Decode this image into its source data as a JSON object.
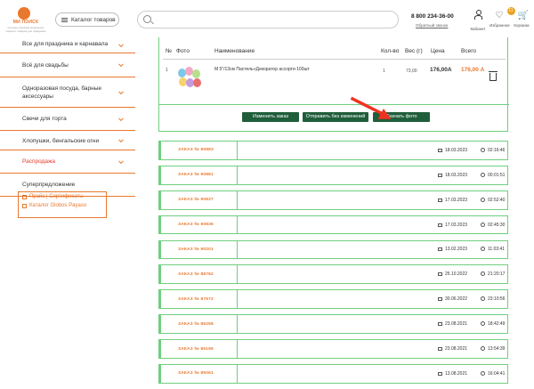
{
  "header": {
    "brand": "МИ ПОИСК",
    "tagline": "интернет-магазин воздушных шаров и товаров для праздника",
    "catalog_label": "Каталог товаров",
    "search_placeholder": "",
    "phone": "8 800 234-36-00",
    "callback_label": "Обратный звонок",
    "cabinet_label": "Кабинет",
    "favorites_label": "Избранное",
    "favorites_count": "11",
    "cart_label": "Корзина",
    "accent": "#e8782e"
  },
  "sidebar": {
    "items": [
      {
        "label": "Все для праздника и карнавала"
      },
      {
        "label": "Всё для свадьбы"
      },
      {
        "label": "Одноразовая посуда, барные аксессуары"
      },
      {
        "label": "Свечи для торта"
      },
      {
        "label": "Хлопушки, бенгальские огни"
      },
      {
        "label": "Распродажа"
      },
      {
        "label": "Суперпредложение"
      }
    ],
    "links": [
      {
        "label": "Прайс | Сертификаты"
      },
      {
        "label": "Каталог Globos Payaso"
      }
    ]
  },
  "order_detail": {
    "columns": {
      "no": "№",
      "photo": "Фото",
      "name": "Наименование",
      "qty": "Кол-во",
      "weight": "Вес (г)",
      "price": "Цена",
      "total": "Всего"
    },
    "items": [
      {
        "no": "1",
        "name": "М 5\"/13см Пастель+Декоратор ассорти 100шт",
        "qty": "1",
        "weight": "73,00",
        "price": "176,00А",
        "total": "176,00 А"
      }
    ],
    "buttons": {
      "change": "Изменить заказ",
      "resend": "Отправить без изменений",
      "download": "Скачать фото"
    }
  },
  "orders": [
    {
      "number": "ЗАКАЗ № 90883",
      "date": "18.03.2023",
      "time": "02:16:46"
    },
    {
      "number": "ЗАКАЗ № 90881",
      "date": "18.03.2023",
      "time": "00:01:51"
    },
    {
      "number": "ЗАКАЗ № 90837",
      "date": "17.03.2023",
      "time": "02:52:40"
    },
    {
      "number": "ЗАКАЗ № 90836",
      "date": "17.03.2023",
      "time": "02:45:30"
    },
    {
      "number": "ЗАКАЗ № 90201",
      "date": "13.02.2023",
      "time": "11:03:41"
    },
    {
      "number": "ЗАКАЗ № 88762",
      "date": "25.10.2022",
      "time": "21:20:17"
    },
    {
      "number": "ЗАКАЗ № 87672",
      "date": "30.06.2022",
      "time": "23:10:56"
    },
    {
      "number": "ЗАКАЗ № 85258",
      "date": "23.08.2021",
      "time": "18:42:49"
    },
    {
      "number": "ЗАКАЗ № 85195",
      "date": "23.08.2021",
      "time": "13:54:39"
    },
    {
      "number": "ЗАКАЗ № 85061",
      "date": "13.08.2021",
      "time": "16:04:41"
    }
  ]
}
